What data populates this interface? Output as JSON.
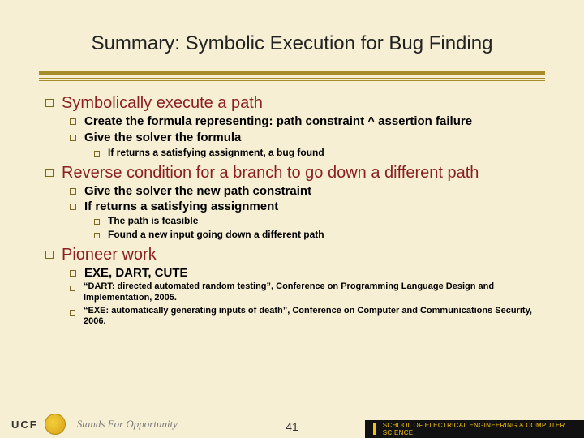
{
  "title": "Summary: Symbolic Execution for Bug Finding",
  "bul": {
    "s1": "Symbolically execute a path",
    "s1a": "Create the formula representing: path constraint ^ assertion failure",
    "s1b": "Give the solver the formula",
    "s1b1": "If returns a satisfying assignment, a bug found",
    "s2": "Reverse condition for a branch to go down a different path",
    "s2a": "Give the solver the new path constraint",
    "s2b": "If returns a satisfying assignment",
    "s2b1": "The path is feasible",
    "s2b2": "Found a new input going down a different path",
    "s3": "Pioneer work",
    "s3a": "EXE, DART, CUTE",
    "s3b": "“DART: directed automated random testing”, Conference on Programming Language Design and Implementation, 2005.",
    "s3c": "“EXE: automatically generating inputs of death”, Conference on Computer and Communications Security, 2006."
  },
  "footer": {
    "ucf": "UCF",
    "tagline": "Stands For Opportunity",
    "page": "41",
    "eecs": "SCHOOL OF ELECTRICAL ENGINEERING & COMPUTER SCIENCE"
  }
}
